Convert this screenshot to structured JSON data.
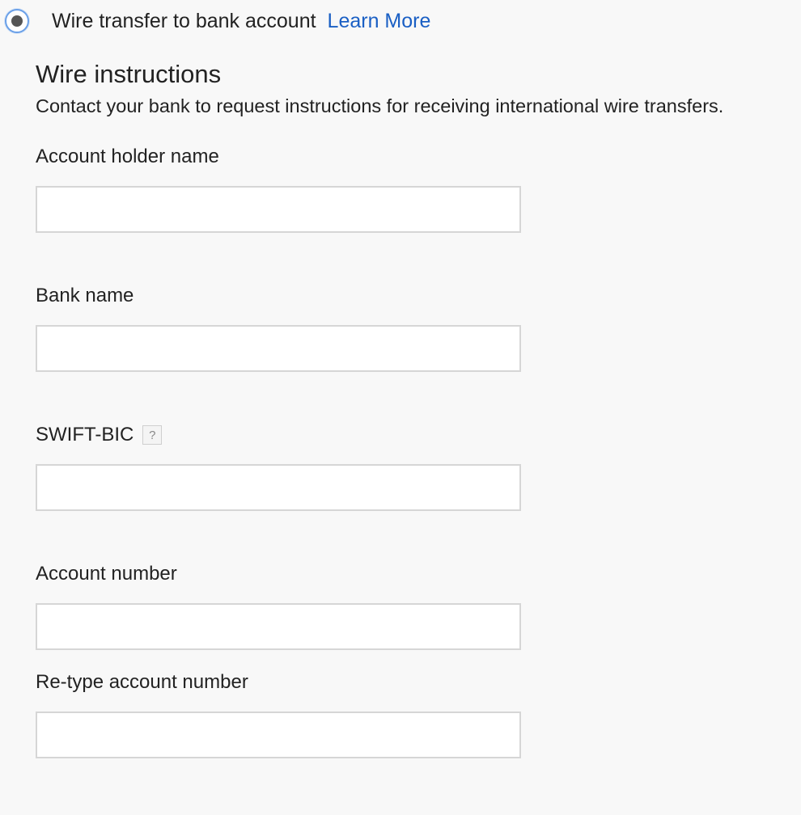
{
  "payment_option": {
    "label": "Wire transfer to bank account",
    "learn_more": "Learn More",
    "selected": true,
    "link_color": "#1a5fc4",
    "radio_ring_color": "#6aa0e8"
  },
  "wire_instructions": {
    "title": "Wire instructions",
    "description": "Contact your bank to request instructions for receiving international wire transfers."
  },
  "fields": {
    "account_holder_name": {
      "label": "Account holder name",
      "value": "",
      "placeholder": ""
    },
    "bank_name": {
      "label": "Bank name",
      "value": "",
      "placeholder": ""
    },
    "swift_bic": {
      "label": "SWIFT-BIC",
      "help": "?",
      "value": "",
      "placeholder": ""
    },
    "account_number": {
      "label": "Account number",
      "value": "",
      "placeholder": ""
    },
    "retype_account_number": {
      "label": "Re-type account number",
      "value": "",
      "placeholder": ""
    }
  },
  "icons": {
    "radio": "radio-selected-icon",
    "help": "help-icon"
  }
}
